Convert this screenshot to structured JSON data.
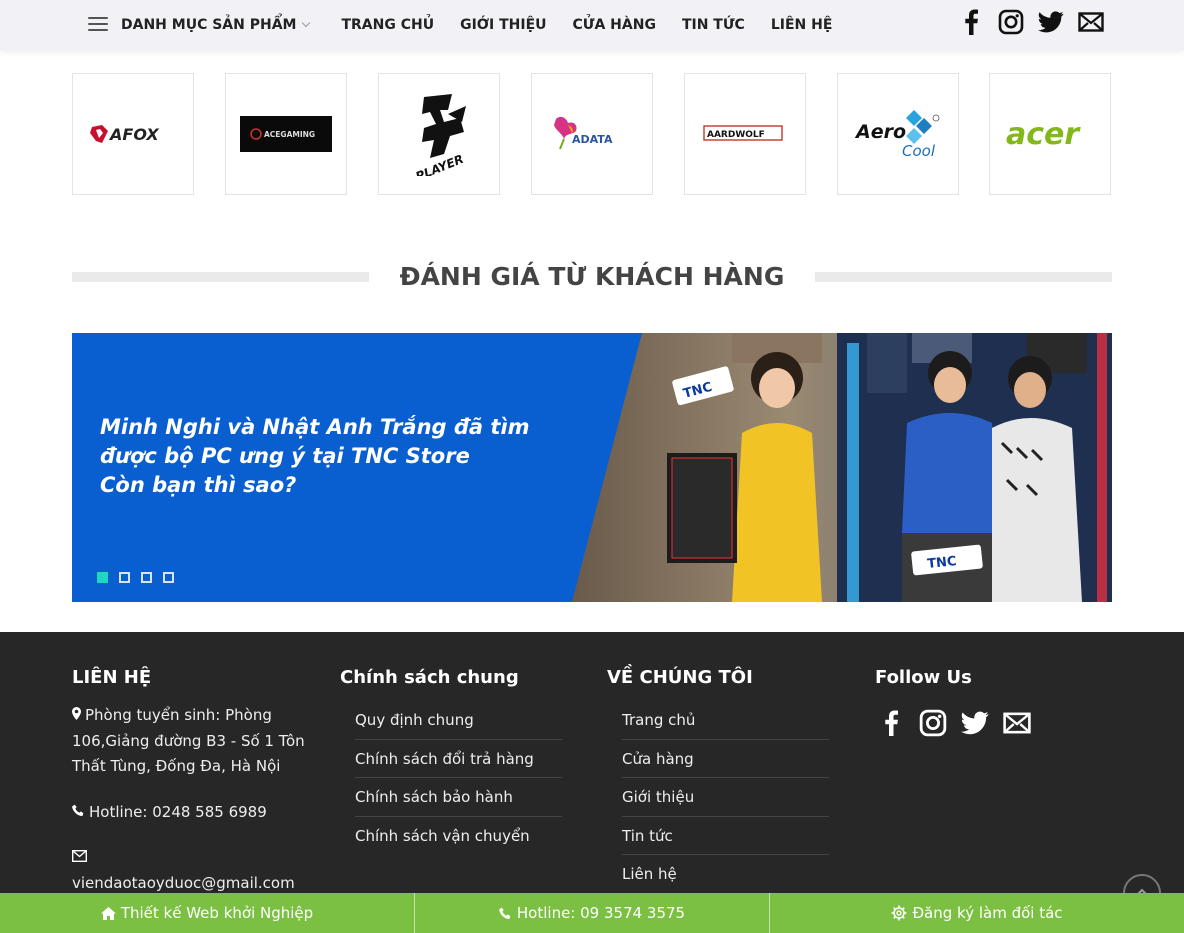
{
  "header": {
    "nav": [
      {
        "label": "DANH MỤC SẢN PHẨM"
      },
      {
        "label": "TRANG CHỦ"
      },
      {
        "label": "GIỚI THIỆU"
      },
      {
        "label": "CỬA HÀNG"
      },
      {
        "label": "TIN TỨC"
      },
      {
        "label": "LIÊN HỆ"
      }
    ],
    "social_icons": [
      "facebook-icon",
      "instagram-icon",
      "twitter-icon",
      "email-icon"
    ]
  },
  "brands": [
    {
      "logo_text": "AFOX"
    },
    {
      "logo_text": "ACEGAMING"
    },
    {
      "logo_text": "PLAYER"
    },
    {
      "logo_text": "ADATA"
    },
    {
      "logo_text": "AARDWOLF"
    },
    {
      "logo_text": "Aero",
      "logo_text2": "Cool"
    },
    {
      "logo_text": "acer"
    }
  ],
  "testimonials": {
    "title": "ĐÁNH GIÁ TỪ KHÁCH HÀNG",
    "banner_lines": [
      "Minh Nghi và Nhật Anh Trắng đã tìm",
      "được bộ PC ưng ý tại TNC Store",
      "Còn bạn thì sao?"
    ],
    "sign_text": "TNC",
    "slide_count": 4,
    "active_slide": 1
  },
  "footer": {
    "contact": {
      "heading": "LIÊN HỆ",
      "address_lines": [
        "Phòng tuyển sinh: Phòng",
        "106,Giảng đường B3 - Số 1 Tôn",
        "Thất Tùng, Đống Đa, Hà Nội"
      ],
      "hotline": "Hotline: 0248 585 6989",
      "email": "viendaotaoyduoc@gmail.com"
    },
    "policy": {
      "heading": "Chính sách chung",
      "links": [
        "Quy định chung",
        "Chính sách đổi trả hàng",
        "Chính sách bảo hành",
        "Chính sách vận chuyển"
      ]
    },
    "about": {
      "heading": "VỀ CHÚNG TÔI",
      "links": [
        "Trang chủ",
        "Cửa hàng",
        "Giới thiệu",
        "Tin tức",
        "Liên hệ"
      ]
    },
    "follow": {
      "heading": "Follow Us"
    }
  },
  "bottom_bar": [
    {
      "label": "Thiết kế Web khởi Nghiệp",
      "icon": "home-icon"
    },
    {
      "label": "Hotline: 09 3574 3575",
      "icon": "phone-icon"
    },
    {
      "label": "Đăng ký làm đối tác",
      "icon": "gear-icon"
    }
  ],
  "colors": {
    "banner_blue": "#0a5fd0",
    "footer_bg": "#272727",
    "bottom_bar_green": "#7bc043",
    "dot_active": "#1fd6c0"
  }
}
